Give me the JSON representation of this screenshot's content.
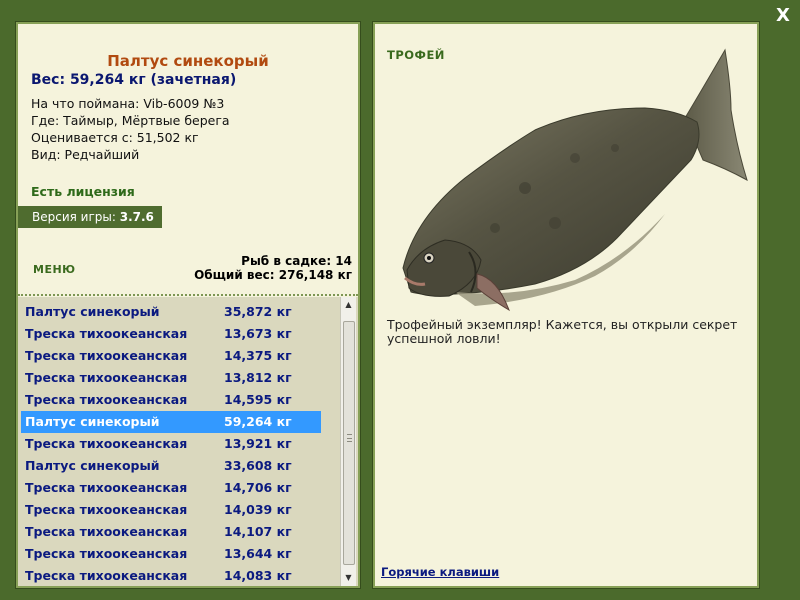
{
  "close_label": "X",
  "fish_card": {
    "title": "Палтус синекорый",
    "weight": "Вес: 59,264 кг (зачетная)",
    "bait": "На что поймана: Vib-6009 №3",
    "location": "Где: Таймыр, Мёртвые берега",
    "valued_from": "Оценивается с: 51,502 кг",
    "rarity": "Вид: Редчайший"
  },
  "license": "Есть лицензия",
  "version": {
    "label": "Версия игры:",
    "value": "3.7.6"
  },
  "menu_label": "МЕНЮ",
  "keepnet": {
    "count": "Рыб в садке: 14",
    "total": "Общий вес: 276,148 кг"
  },
  "catch_list": [
    {
      "name": "Палтус синекорый",
      "weight": "35,872 кг"
    },
    {
      "name": "Треска тихоокеанская",
      "weight": "13,673 кг"
    },
    {
      "name": "Треска тихоокеанская",
      "weight": "14,375 кг"
    },
    {
      "name": "Треска тихоокеанская",
      "weight": "13,812 кг"
    },
    {
      "name": "Треска тихоокеанская",
      "weight": "14,595 кг"
    },
    {
      "name": "Палтус синекорый",
      "weight": "59,264 кг",
      "selected": true
    },
    {
      "name": "Треска тихоокеанская",
      "weight": "13,921 кг"
    },
    {
      "name": "Палтус синекорый",
      "weight": "33,608 кг"
    },
    {
      "name": "Треска тихоокеанская",
      "weight": "14,706 кг"
    },
    {
      "name": "Треска тихоокеанская",
      "weight": "14,039 кг"
    },
    {
      "name": "Треска тихоокеанская",
      "weight": "14,107 кг"
    },
    {
      "name": "Треска тихоокеанская",
      "weight": "13,644 кг"
    },
    {
      "name": "Треска тихоокеанская",
      "weight": "14,083 кг"
    }
  ],
  "trophy": {
    "label": "ТРОФЕЙ",
    "text": "Трофейный экземпляр! Кажется, вы открыли секрет успешной ловли!"
  },
  "hotkeys_label": "Горячие клавиши",
  "colors": {
    "frame": "#4b6a2c",
    "panel": "#f5f3dc",
    "title": "#b14a10",
    "selected_row": "#3399ff"
  },
  "icons": {
    "close": "close-icon",
    "scroll_up": "scroll-up-arrow-icon",
    "scroll_down": "scroll-down-arrow-icon",
    "fish": "halibut-fish-image"
  }
}
